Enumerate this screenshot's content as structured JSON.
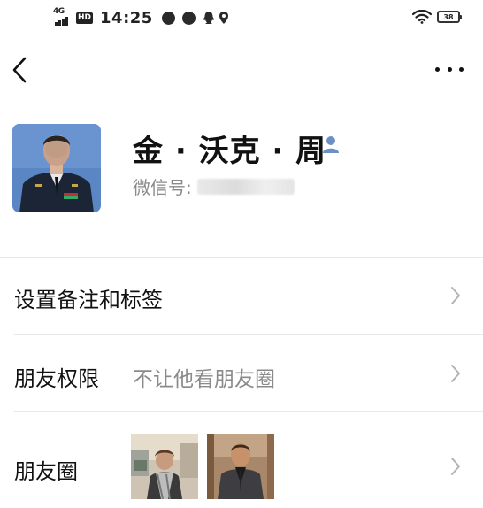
{
  "status_bar": {
    "network": "4G",
    "hd": "HD",
    "time": "14:25",
    "battery": "38"
  },
  "nav": {
    "back_icon": "chevron-left-icon",
    "more_icon": "more-dots-icon"
  },
  "profile": {
    "name": "金 · 沃克 · 周",
    "wechat_id_label": "微信号:",
    "contact_badge_icon": "contact-person-icon"
  },
  "rows": {
    "remark": {
      "label": "设置备注和标签"
    },
    "permission": {
      "label": "朋友权限",
      "value": "不让他看朋友圈"
    },
    "moments": {
      "label": "朋友圈"
    }
  },
  "colors": {
    "background": "#ffffff",
    "primary_text": "#111111",
    "secondary_text": "#8a8a8a",
    "divider": "#e8e8e8",
    "contact_badge": "#6b8fc7",
    "chevron": "#b3b3b3"
  }
}
